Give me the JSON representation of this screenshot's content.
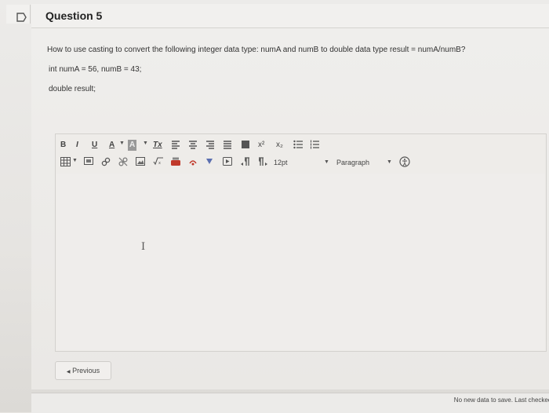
{
  "question": {
    "title": "Question 5",
    "prompt": "How to use casting to convert the following integer data type: numA and numB  to double data type result = numA/numB?",
    "line2": "int numA = 56, numB = 43;",
    "line3": "double result;"
  },
  "toolbar": {
    "bold": "B",
    "italic": "I",
    "underline": "U",
    "font_color": "A",
    "bg_color": "A",
    "clear_format": "Tx",
    "superscript": "x²",
    "subscript": "x₂",
    "font_size": "12pt",
    "paragraph": "Paragraph"
  },
  "nav": {
    "previous": "Previous"
  },
  "footer": {
    "save_status": "No new data to save. Last checked a"
  }
}
